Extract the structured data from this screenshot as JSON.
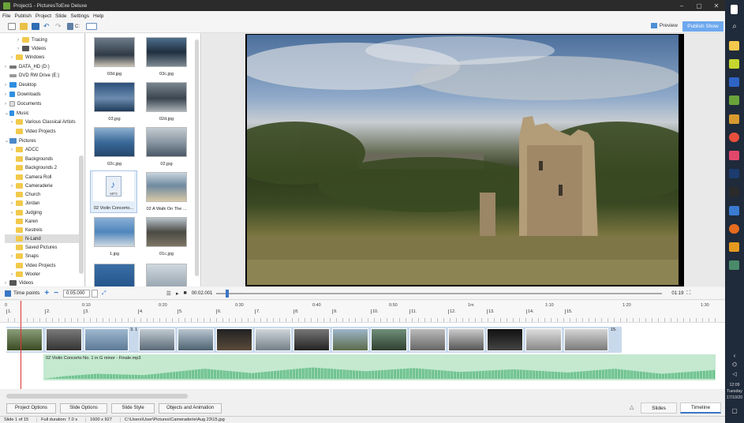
{
  "window": {
    "title": "Project1 - PicturesToExe Deluxe",
    "controls": [
      "–",
      "▢",
      "✕"
    ]
  },
  "menu": [
    "File",
    "Publish",
    "Project",
    "Slide",
    "Settings",
    "Help"
  ],
  "toolbar": {
    "drive_label": "C:",
    "preview_label": "Preview",
    "publish_label": "Publish Show"
  },
  "tree": [
    {
      "label": "Tracing",
      "icon": "folder"
    },
    {
      "label": "Videos",
      "icon": "video-folder"
    },
    {
      "label": "Windows",
      "icon": "folder"
    },
    {
      "label": "DATA_HD (D:)",
      "icon": "drive"
    },
    {
      "label": "DVD RW Drive (E:)",
      "icon": "dvd"
    },
    {
      "label": "Desktop",
      "icon": "desktop"
    },
    {
      "label": "Downloads",
      "icon": "downloads"
    },
    {
      "label": "Documents",
      "icon": "documents"
    },
    {
      "label": "Music",
      "icon": "music"
    },
    {
      "label": "Various Classical Artists",
      "icon": "folder"
    },
    {
      "label": "Video Projects",
      "icon": "folder"
    },
    {
      "label": "Pictures",
      "icon": "pictures"
    },
    {
      "label": "ADCC",
      "icon": "folder"
    },
    {
      "label": "Backgrounds",
      "icon": "folder"
    },
    {
      "label": "Backgrounds 2",
      "icon": "folder"
    },
    {
      "label": "Camera Roll",
      "icon": "folder"
    },
    {
      "label": "Cameraderie",
      "icon": "folder"
    },
    {
      "label": "Church",
      "icon": "folder"
    },
    {
      "label": "Jordan",
      "icon": "folder"
    },
    {
      "label": "Judging",
      "icon": "folder"
    },
    {
      "label": "Karen",
      "icon": "folder"
    },
    {
      "label": "Kestrels",
      "icon": "folder"
    },
    {
      "label": "N-Land",
      "icon": "folder",
      "selected": true
    },
    {
      "label": "Saved Pictures",
      "icon": "folder"
    },
    {
      "label": "Snaps",
      "icon": "folder"
    },
    {
      "label": "Video Projects",
      "icon": "folder"
    },
    {
      "label": "Wooler",
      "icon": "folder"
    },
    {
      "label": "Videos",
      "icon": "video-folder"
    }
  ],
  "thumbnails": [
    {
      "name": "03d.jpg"
    },
    {
      "name": "03c.jpg"
    },
    {
      "name": "03.jpg"
    },
    {
      "name": "02d.jpg"
    },
    {
      "name": "02c.jpg"
    },
    {
      "name": "02.jpg"
    },
    {
      "name": "02 Violin Concerto...",
      "kind": "audio",
      "badge": "MP3"
    },
    {
      "name": "02 A Walk On The ..."
    },
    {
      "name": "1.jpg"
    },
    {
      "name": "01c.jpg"
    }
  ],
  "timebar": {
    "time_points_label": "Time points",
    "duration_value": "0:05.000",
    "position": "00:02.001",
    "total": "01:19",
    "slider_progress": 0.02
  },
  "ruler": {
    "times": [
      "0",
      "0:10",
      "0:20",
      "0:30",
      "0:40",
      "0:50",
      "1m",
      "1:10",
      "1:20",
      "1:30"
    ],
    "markers": [
      "1.",
      "2.",
      "3.",
      "4.",
      "5.",
      "6.",
      "7.",
      "8.",
      "9.",
      "10.",
      "11.",
      "12.",
      "13.",
      "14.",
      "15."
    ]
  },
  "slides_row": {
    "labels": [
      "3. 1",
      "15."
    ],
    "count": 15
  },
  "audio": {
    "label": "02 Violin Concerto No. 1 in G minor - Finale.mp3"
  },
  "bottom": {
    "buttons": [
      "Project Options",
      "Slide Options",
      "Slide Style",
      "Objects and Animation"
    ],
    "tabs": [
      "Slides",
      "Timeline"
    ],
    "active_tab": "Timeline"
  },
  "status": [
    "Slide 1 of 15",
    "Full duration: 7.0 s",
    "1600 x 927",
    "C:\\Users\\User\\Pictures\\Cameraderie\\Aug 23\\15.jpg"
  ],
  "taskbar": {
    "time": "12:09",
    "day": "Tuesday",
    "date": "17/10/20"
  },
  "colors": {
    "accent": "#6ea8ee",
    "audio_track": "#c4e9cf",
    "wave": "#4cb276",
    "playhead": "#dd3333"
  }
}
